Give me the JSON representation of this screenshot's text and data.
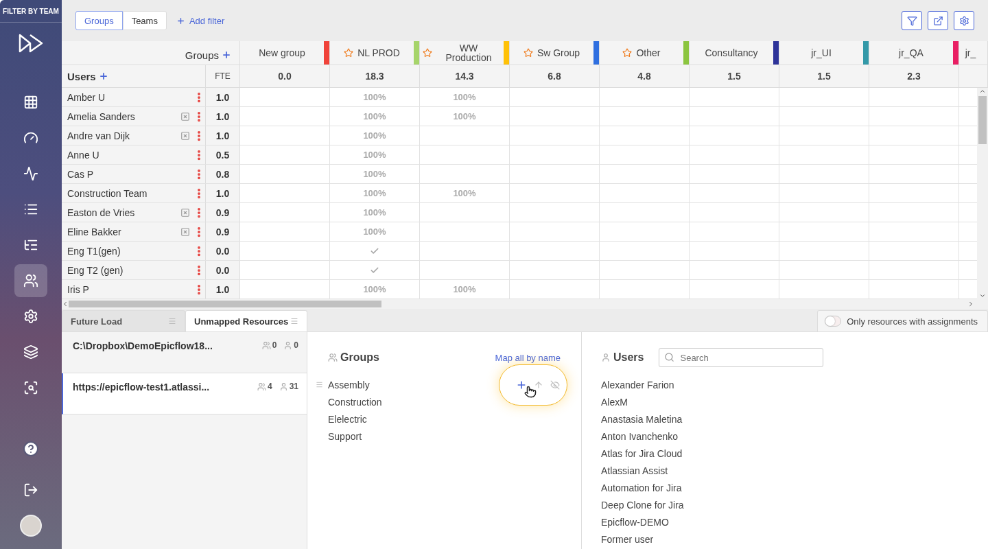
{
  "sidebar": {
    "title": "FILTER BY TEAM",
    "nav": [
      {
        "kind": "grid",
        "selected": false
      },
      {
        "kind": "gauge",
        "selected": false
      },
      {
        "kind": "activity",
        "selected": false
      },
      {
        "kind": "list",
        "selected": false
      },
      {
        "kind": "tree",
        "selected": false
      },
      {
        "kind": "users",
        "selected": true
      },
      {
        "kind": "settings",
        "selected": false
      },
      {
        "kind": "layers",
        "selected": false
      },
      {
        "kind": "analysis",
        "selected": false
      }
    ],
    "bottom": [
      {
        "kind": "help"
      },
      {
        "kind": "logout"
      },
      {
        "kind": "avatar"
      }
    ]
  },
  "toolbar": {
    "view_tabs": [
      {
        "label": "Groups",
        "selected": true
      },
      {
        "label": "Teams",
        "selected": false
      }
    ],
    "add_filter": "Add filter",
    "actions": [
      {
        "kind": "filter"
      },
      {
        "kind": "export"
      },
      {
        "kind": "settings"
      }
    ]
  },
  "grid": {
    "groups_label": "Groups",
    "users_label": "Users",
    "fte_label": "FTE",
    "columns": [
      {
        "name": "New group",
        "starred": false,
        "color": "#f0433a",
        "total": "0.0"
      },
      {
        "name": "NL PROD",
        "starred": true,
        "color": "#a6d46a",
        "total": "18.3"
      },
      {
        "name": "WW Production",
        "starred": true,
        "color": "#ffc107",
        "total": "14.3"
      },
      {
        "name": "Sw Group",
        "starred": true,
        "color": "#2f6fe0",
        "total": "6.8"
      },
      {
        "name": "Other",
        "starred": true,
        "color": "#8bc53f",
        "total": "4.8"
      },
      {
        "name": "Consultancy",
        "starred": false,
        "color": "#2d3399",
        "total": "1.5"
      },
      {
        "name": "jr_UI",
        "starred": false,
        "color": "#3399a8",
        "total": "1.5"
      },
      {
        "name": "jr_QA",
        "starred": false,
        "color": "#e91e63",
        "total": "2.3"
      },
      {
        "name": "jr_",
        "starred": false
      }
    ],
    "rows": [
      {
        "name": "Amber U",
        "excluded": false,
        "fte": "1.0",
        "cells": [
          {
            "kind": "empty"
          },
          {
            "kind": "percent",
            "text": "100%"
          },
          {
            "kind": "percent",
            "text": "100%"
          },
          {
            "kind": "empty"
          },
          {
            "kind": "empty"
          },
          {
            "kind": "empty"
          },
          {
            "kind": "empty"
          },
          {
            "kind": "empty"
          }
        ]
      },
      {
        "name": "Amelia Sanders",
        "excluded": true,
        "fte": "1.0",
        "cells": [
          {
            "kind": "empty"
          },
          {
            "kind": "percent",
            "text": "100%"
          },
          {
            "kind": "percent",
            "text": "100%"
          },
          {
            "kind": "empty"
          },
          {
            "kind": "empty"
          },
          {
            "kind": "empty"
          },
          {
            "kind": "empty"
          },
          {
            "kind": "empty"
          }
        ]
      },
      {
        "name": "Andre van Dijk",
        "excluded": true,
        "fte": "1.0",
        "cells": [
          {
            "kind": "empty"
          },
          {
            "kind": "percent",
            "text": "100%"
          },
          {
            "kind": "empty"
          },
          {
            "kind": "empty"
          },
          {
            "kind": "empty"
          },
          {
            "kind": "empty"
          },
          {
            "kind": "empty"
          },
          {
            "kind": "empty"
          }
        ]
      },
      {
        "name": "Anne U",
        "excluded": false,
        "fte": "0.5",
        "cells": [
          {
            "kind": "empty"
          },
          {
            "kind": "percent",
            "text": "100%"
          },
          {
            "kind": "empty"
          },
          {
            "kind": "empty"
          },
          {
            "kind": "empty"
          },
          {
            "kind": "empty"
          },
          {
            "kind": "empty"
          },
          {
            "kind": "empty"
          }
        ]
      },
      {
        "name": "Cas P",
        "excluded": false,
        "fte": "0.8",
        "cells": [
          {
            "kind": "empty"
          },
          {
            "kind": "percent",
            "text": "100%"
          },
          {
            "kind": "empty"
          },
          {
            "kind": "empty"
          },
          {
            "kind": "empty"
          },
          {
            "kind": "empty"
          },
          {
            "kind": "empty"
          },
          {
            "kind": "empty"
          }
        ]
      },
      {
        "name": "Construction Team",
        "excluded": false,
        "fte": "1.0",
        "cells": [
          {
            "kind": "empty"
          },
          {
            "kind": "percent",
            "text": "100%"
          },
          {
            "kind": "percent",
            "text": "100%"
          },
          {
            "kind": "empty"
          },
          {
            "kind": "empty"
          },
          {
            "kind": "empty"
          },
          {
            "kind": "empty"
          },
          {
            "kind": "empty"
          }
        ]
      },
      {
        "name": "Easton de Vries",
        "excluded": true,
        "fte": "0.9",
        "cells": [
          {
            "kind": "empty"
          },
          {
            "kind": "percent",
            "text": "100%"
          },
          {
            "kind": "empty"
          },
          {
            "kind": "empty"
          },
          {
            "kind": "empty"
          },
          {
            "kind": "empty"
          },
          {
            "kind": "empty"
          },
          {
            "kind": "empty"
          }
        ]
      },
      {
        "name": "Eline Bakker",
        "excluded": true,
        "fte": "0.9",
        "cells": [
          {
            "kind": "empty"
          },
          {
            "kind": "percent",
            "text": "100%"
          },
          {
            "kind": "empty"
          },
          {
            "kind": "empty"
          },
          {
            "kind": "empty"
          },
          {
            "kind": "empty"
          },
          {
            "kind": "empty"
          },
          {
            "kind": "empty"
          }
        ]
      },
      {
        "name": "Eng T1(gen)",
        "excluded": false,
        "fte": "0.0",
        "cells": [
          {
            "kind": "empty"
          },
          {
            "kind": "check"
          },
          {
            "kind": "empty"
          },
          {
            "kind": "empty"
          },
          {
            "kind": "empty"
          },
          {
            "kind": "empty"
          },
          {
            "kind": "empty"
          },
          {
            "kind": "empty"
          }
        ]
      },
      {
        "name": "Eng T2 (gen)",
        "excluded": false,
        "fte": "0.0",
        "cells": [
          {
            "kind": "empty"
          },
          {
            "kind": "check"
          },
          {
            "kind": "empty"
          },
          {
            "kind": "empty"
          },
          {
            "kind": "empty"
          },
          {
            "kind": "empty"
          },
          {
            "kind": "empty"
          },
          {
            "kind": "empty"
          }
        ]
      },
      {
        "name": "Iris P",
        "excluded": false,
        "fte": "1.0",
        "cells": [
          {
            "kind": "empty"
          },
          {
            "kind": "percent",
            "text": "100%"
          },
          {
            "kind": "percent",
            "text": "100%"
          },
          {
            "kind": "empty"
          },
          {
            "kind": "empty"
          },
          {
            "kind": "empty"
          },
          {
            "kind": "empty"
          },
          {
            "kind": "empty"
          }
        ]
      }
    ]
  },
  "bottom_tabs": [
    {
      "label": "Future Load",
      "selected": false
    },
    {
      "label": "Unmapped Resources",
      "selected": true
    }
  ],
  "assignments_toggle": {
    "label": "Only resources with assignments",
    "on": false
  },
  "sources": [
    {
      "name": "C:\\Dropbox\\DemoEpicflow18...",
      "groups": "0",
      "users": "0",
      "selected": false
    },
    {
      "name": "https://epicflow-test1.atlassi...",
      "groups": "4",
      "users": "31",
      "selected": true
    }
  ],
  "groups_panel": {
    "title": "Groups",
    "map_link": "Map all by name",
    "items": [
      {
        "name": "Assembly",
        "hovered": true
      },
      {
        "name": "Construction",
        "hovered": false
      },
      {
        "name": "Elelectric",
        "hovered": false
      },
      {
        "name": "Support",
        "hovered": false
      }
    ]
  },
  "users_panel": {
    "title": "Users",
    "search": {
      "placeholder": "Search"
    },
    "items": [
      "Alexander Farion",
      "AlexM",
      "Anastasia Maletina",
      "Anton Ivanchenko",
      "Atlas for Jira Cloud",
      "Atlassian Assist",
      "Automation for Jira",
      "Deep Clone for Jira",
      "Epicflow-DEMO",
      "Former user"
    ]
  }
}
